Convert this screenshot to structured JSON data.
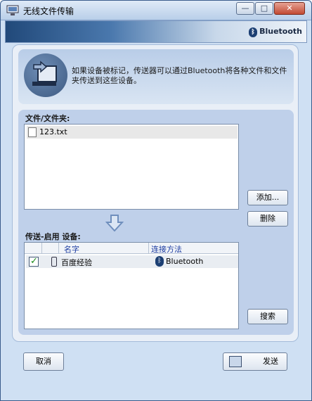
{
  "window": {
    "title": "无线文件传输",
    "controls": {
      "minimize": "—",
      "maximize": "□",
      "close": "✕"
    }
  },
  "banner": {
    "brand": "Bluetooth",
    "brand_icon": "bluetooth-icon"
  },
  "header": {
    "description": "如果设备被标记，传送器可以通过Bluetooth将各种文件和文件夹传送到这些设备。"
  },
  "files": {
    "label": "文件/文件夹:",
    "items": [
      {
        "name": "123.txt"
      }
    ],
    "add_label": "添加...",
    "delete_label": "删除"
  },
  "devices": {
    "label": "传送-启用 设备:",
    "columns": {
      "name": "名字",
      "method": "连接方法"
    },
    "items": [
      {
        "checked": true,
        "name": "百度经验",
        "method": "Bluetooth"
      }
    ],
    "search_label": "搜索"
  },
  "footer": {
    "cancel_label": "取消",
    "send_label": "发送"
  },
  "colors": {
    "accent": "#1c3f73",
    "panel_bg": "#bfd0ea"
  }
}
